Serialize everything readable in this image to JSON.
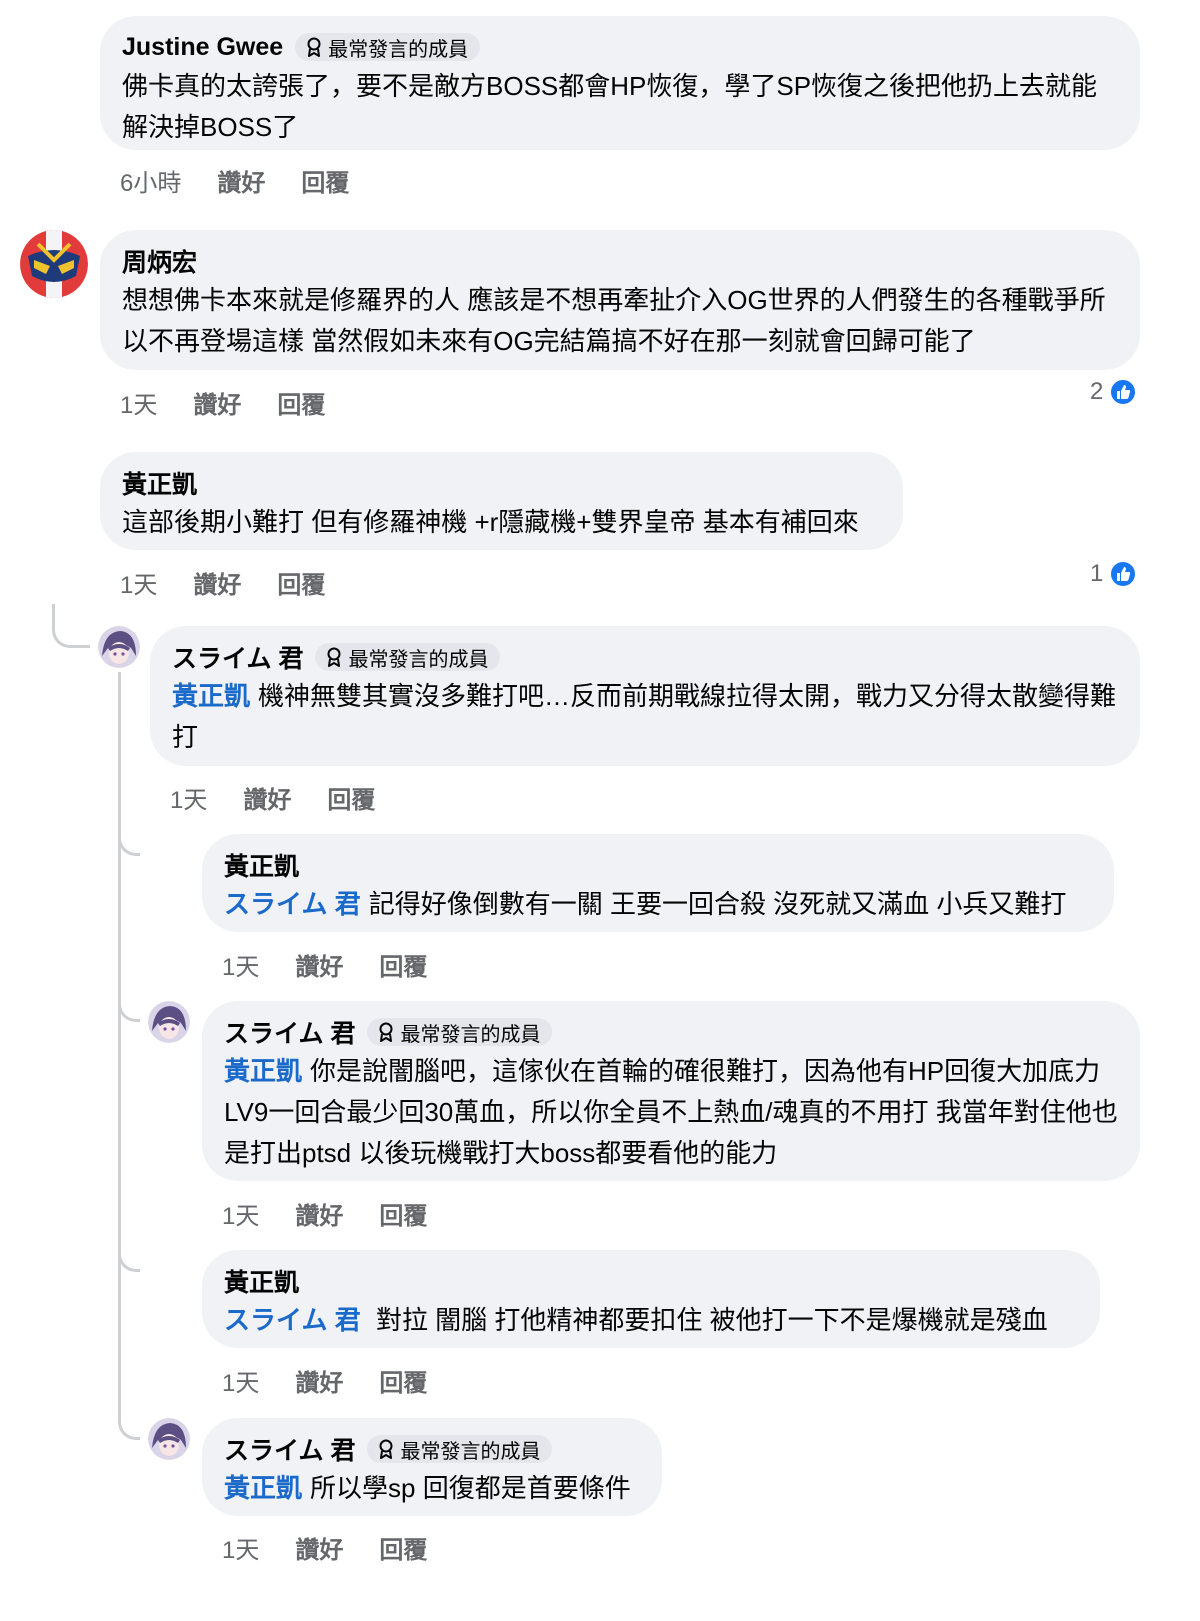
{
  "badge_label": "最常發言的成員",
  "comments": [
    {
      "author": "Justine Gwee",
      "badge": "最常發言的成員",
      "text": "佛卡真的太誇張了，要不是敵方BOSS都會HP恢復，學了SP恢復之後把他扔上去就能解決掉BOSS了",
      "time": "6小時",
      "like": "讚好",
      "reply": "回覆"
    },
    {
      "author": "周炳宏",
      "text": "想想佛卡本來就是修羅界的人 應該是不想再牽扯介入OG世界的人們發生的各種戰爭所以不再登場這樣 當然假如未來有OG完結篇搞不好在那一刻就會回歸可能了",
      "time": "1天",
      "like": "讚好",
      "reply": "回覆",
      "reactions": "2"
    },
    {
      "author": "黃正凱",
      "text": "這部後期小難打 但有修羅神機 +r隱藏機+雙界皇帝 基本有補回來",
      "time": "1天",
      "like": "讚好",
      "reply": "回覆",
      "reactions": "1"
    }
  ],
  "replies": [
    {
      "author": "スライム 君",
      "badge": "最常發言的成員",
      "mention": "黃正凱",
      "text": "機神無雙其實沒多難打吧…反而前期戰線拉得太開，戰力又分得太散變得難打",
      "time": "1天",
      "like": "讚好",
      "reply": "回覆"
    },
    {
      "author": "黃正凱",
      "mention": "スライム 君",
      "text": "記得好像倒數有一關 王要一回合殺 沒死就又滿血 小兵又難打",
      "time": "1天",
      "like": "讚好",
      "reply": "回覆"
    },
    {
      "author": "スライム 君",
      "badge": "最常發言的成員",
      "mention": "黃正凱",
      "text": "你是說闇腦吧，這傢伙在首輪的確很難打，因為他有HP回復大加底力LV9一回合最少回30萬血，所以你全員不上熱血/魂真的不用打 我當年對住他也是打出ptsd 以後玩機戰打大boss都要看他的能力",
      "time": "1天",
      "like": "讚好",
      "reply": "回覆"
    },
    {
      "author": "黃正凱",
      "mention": "スライム 君",
      "text": " 對拉 闇腦  打他精神都要扣住 被他打一下不是爆機就是殘血",
      "time": "1天",
      "like": "讚好",
      "reply": "回覆"
    },
    {
      "author": "スライム 君",
      "badge": "最常發言的成員",
      "mention": "黃正凱",
      "text": "所以學sp 回復都是首要條件",
      "time": "1天",
      "like": "讚好",
      "reply": "回覆"
    }
  ]
}
